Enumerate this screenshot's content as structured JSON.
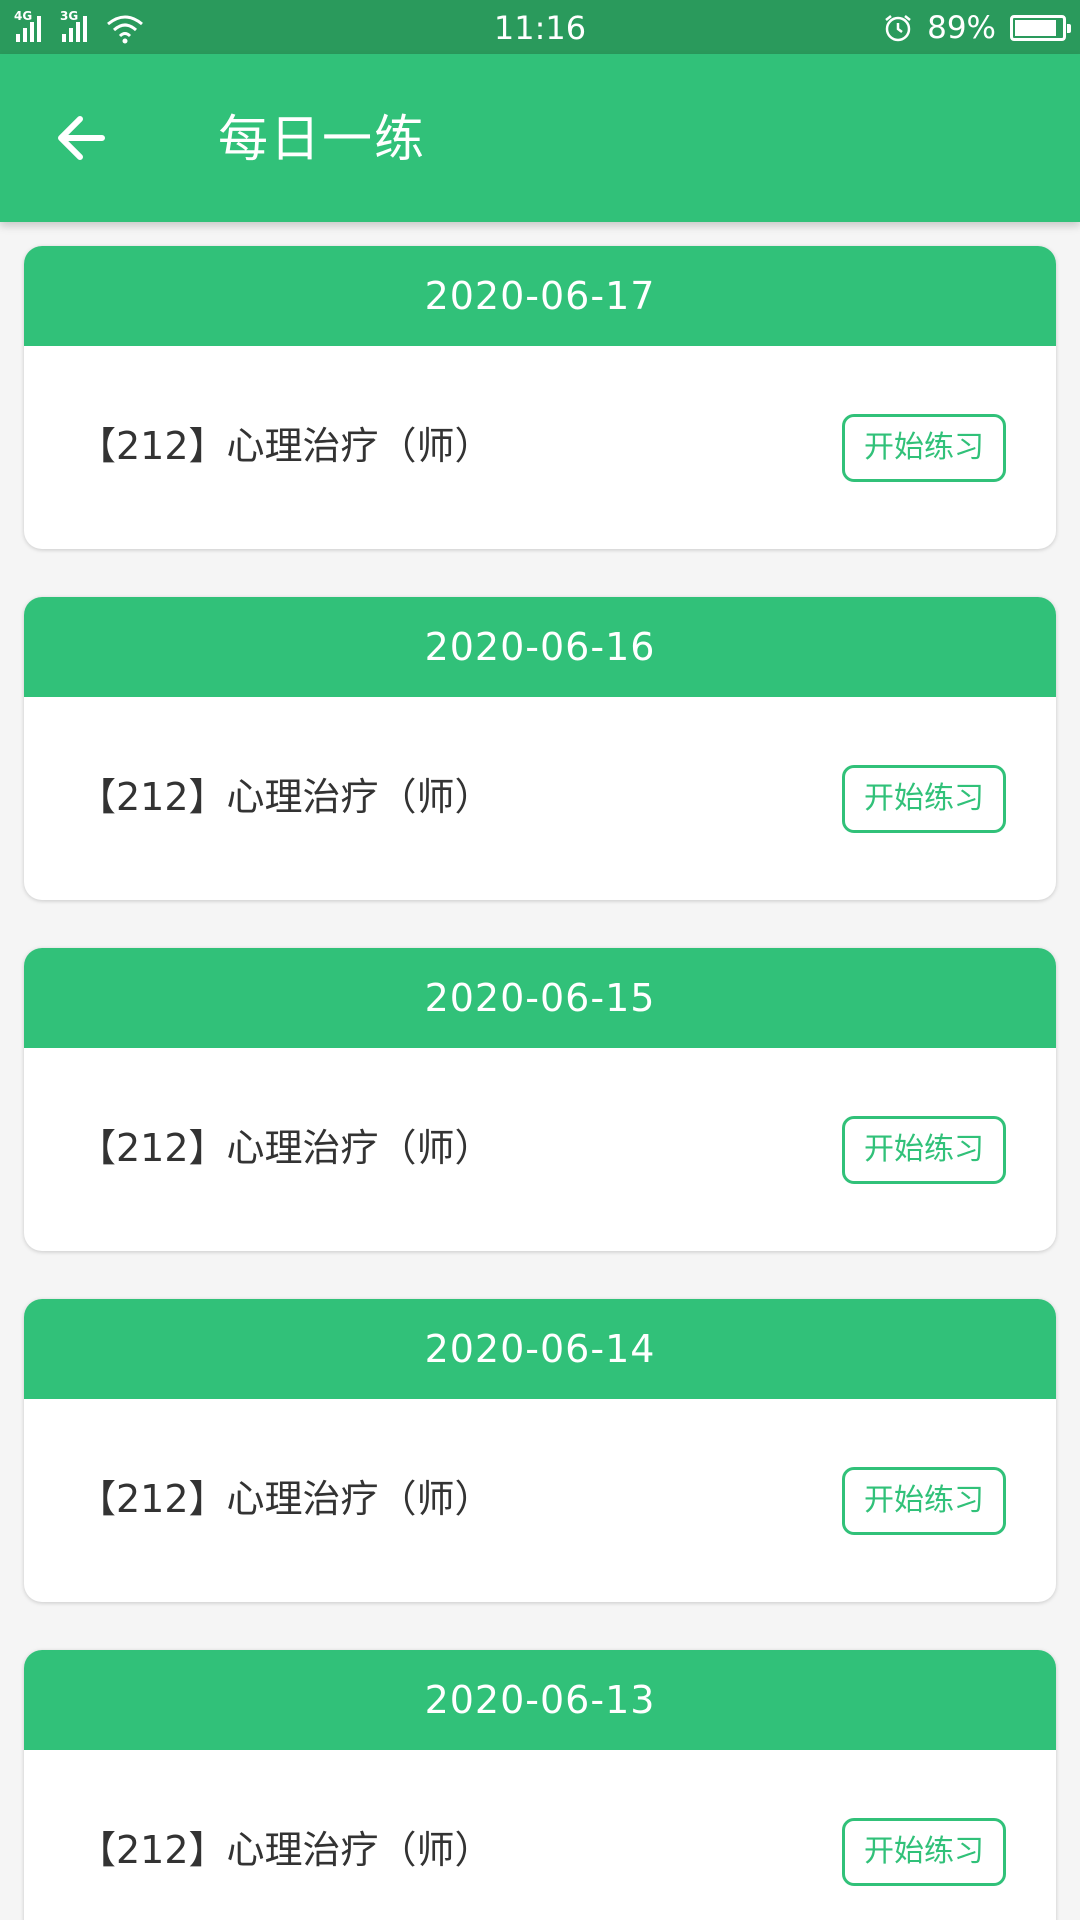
{
  "status_bar": {
    "network_1": "4G",
    "network_2": "3G",
    "time": "11:16",
    "battery_percent": "89%",
    "battery_level": 0.89
  },
  "app_bar": {
    "title": "每日一练",
    "back_icon": "arrow-left-icon"
  },
  "colors": {
    "primary": "#31c179",
    "status_bar": "#2a9a5c",
    "background": "#f5f5f5",
    "text": "#333333"
  },
  "items": [
    {
      "date": "2020-06-17",
      "course": "【212】心理治疗（师）",
      "button": "开始练习"
    },
    {
      "date": "2020-06-16",
      "course": "【212】心理治疗（师）",
      "button": "开始练习"
    },
    {
      "date": "2020-06-15",
      "course": "【212】心理治疗（师）",
      "button": "开始练习"
    },
    {
      "date": "2020-06-14",
      "course": "【212】心理治疗（师）",
      "button": "开始练习"
    },
    {
      "date": "2020-06-13",
      "course": "【212】心理治疗（师）",
      "button": "开始练习"
    }
  ]
}
